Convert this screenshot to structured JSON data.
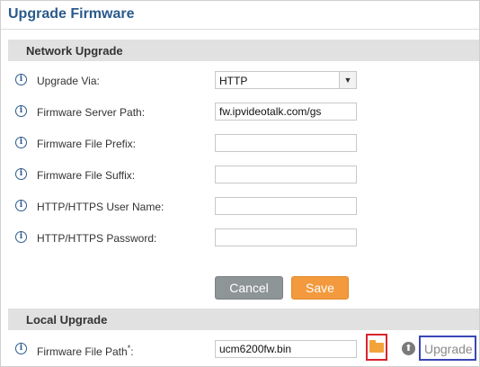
{
  "page": {
    "title": "Upgrade Firmware"
  },
  "network_upgrade": {
    "section_title": "Network Upgrade",
    "upgrade_via": {
      "label": "Upgrade Via:",
      "value": "HTTP"
    },
    "firmware_server_path": {
      "label": "Firmware Server Path:",
      "value": "fw.ipvideotalk.com/gs"
    },
    "firmware_file_prefix": {
      "label": "Firmware File Prefix:",
      "value": ""
    },
    "firmware_file_suffix": {
      "label": "Firmware File Suffix:",
      "value": ""
    },
    "http_user_name": {
      "label": "HTTP/HTTPS User Name:",
      "value": ""
    },
    "http_password": {
      "label": "HTTP/HTTPS Password:",
      "value": ""
    },
    "cancel_label": "Cancel",
    "save_label": "Save"
  },
  "local_upgrade": {
    "section_title": "Local Upgrade",
    "firmware_file_path": {
      "label": "Firmware File Path",
      "required_mark": "*",
      "suffix": ":",
      "value": "ucm6200fw.bin"
    },
    "upgrade_label": "Upgrade"
  },
  "icons": {
    "info": "info-icon",
    "dropdown": "chevron-down-icon",
    "browse": "folder-icon",
    "upload": "upload-icon"
  },
  "colors": {
    "title": "#2b5a8c",
    "section_bar": "#e1e1e1",
    "save_button": "#f29a3d",
    "cancel_button": "#8e9597",
    "folder_highlight": "#d9232d",
    "upgrade_highlight": "#3a47b5"
  }
}
